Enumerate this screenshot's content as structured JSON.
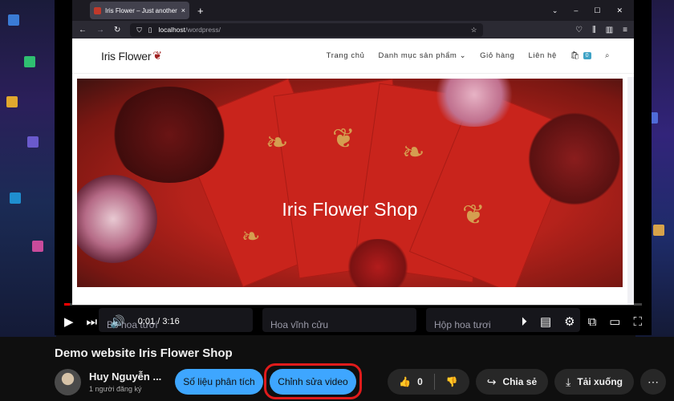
{
  "browser": {
    "tab_title": "Iris Flower – Just another Word",
    "tab_close": "×",
    "new_tab": "+",
    "url_host": "localhost",
    "url_path": "/wordpress/"
  },
  "site": {
    "logo": "Iris Flower",
    "menu": [
      "Trang chủ",
      "Danh mục sản phẩm",
      "Giỏ hàng",
      "Liên hệ"
    ],
    "cart_count": "0",
    "hero_title": "Iris Flower Shop"
  },
  "player": {
    "time": "0:01 / 3:16",
    "progress": 0.005,
    "suggestions": [
      "Bó hoa tươi",
      "Hoa vĩnh cửu",
      "Hộp hoa tươi"
    ]
  },
  "video": {
    "title": "Demo website Iris Flower Shop"
  },
  "channel": {
    "name": "Huy Nguyễn ...",
    "subscribers": "1 người đăng ký"
  },
  "buttons": {
    "analytics": "Số liệu phân tích",
    "edit": "Chỉnh sửa video",
    "likes": "0",
    "share": "Chia sẻ",
    "download": "Tải xuống"
  },
  "colors": {
    "accent": "#3ea6ff",
    "highlight": "#e01b1b",
    "progress": "#ff0000"
  }
}
